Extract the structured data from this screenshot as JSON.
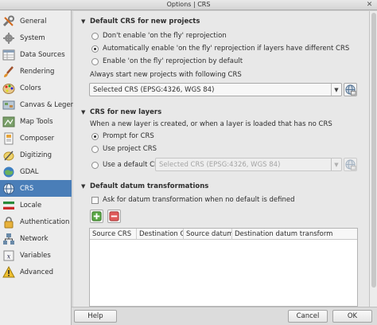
{
  "window": {
    "title": "Options | CRS"
  },
  "sidebar": {
    "items": [
      {
        "label": "General"
      },
      {
        "label": "System"
      },
      {
        "label": "Data Sources"
      },
      {
        "label": "Rendering"
      },
      {
        "label": "Colors"
      },
      {
        "label": "Canvas & Legend"
      },
      {
        "label": "Map Tools"
      },
      {
        "label": "Composer"
      },
      {
        "label": "Digitizing"
      },
      {
        "label": "GDAL"
      },
      {
        "label": "CRS"
      },
      {
        "label": "Locale"
      },
      {
        "label": "Authentication"
      },
      {
        "label": "Network"
      },
      {
        "label": "Variables"
      },
      {
        "label": "Advanced"
      }
    ],
    "active": "CRS"
  },
  "default_crs": {
    "title": "Default CRS for new projects",
    "options": [
      "Don't enable 'on the fly' reprojection",
      "Automatically enable 'on the fly' reprojection if layers have different CRS",
      "Enable 'on the fly' reprojection by default"
    ],
    "selected": 1,
    "always_start_label": "Always start new projects with following CRS",
    "crs_value": "Selected CRS (EPSG:4326, WGS 84)"
  },
  "new_layers": {
    "title": "CRS for new layers",
    "description": "When a new layer is created, or when a layer is loaded that has no CRS",
    "options": [
      "Prompt for CRS",
      "Use project CRS",
      "Use a default CRS"
    ],
    "selected": 0,
    "default_crs_value": "Selected CRS (EPSG:4326, WGS 84)"
  },
  "datum": {
    "title": "Default datum transformations",
    "ask_label": "Ask for datum transformation when no default is defined",
    "columns": [
      "Source CRS",
      "Destination CRS",
      "Source datum tr",
      "Destination datum transform"
    ]
  },
  "footer": {
    "help_label": "Help",
    "cancel_label": "Cancel",
    "ok_label": "OK"
  },
  "icons": {
    "nav": [
      "wrench-icon",
      "gear-icon",
      "data-sources-icon",
      "brush-icon",
      "palette-icon",
      "canvas-icon",
      "map-tools-icon",
      "composer-icon",
      "digitizing-icon",
      "gdal-icon",
      "globe-icon",
      "flag-icon",
      "padlock-icon",
      "network-icon",
      "variables-icon",
      "warning-icon"
    ]
  },
  "colors": {
    "accent": "#4a7eb8",
    "active_text": "#ffffff"
  }
}
